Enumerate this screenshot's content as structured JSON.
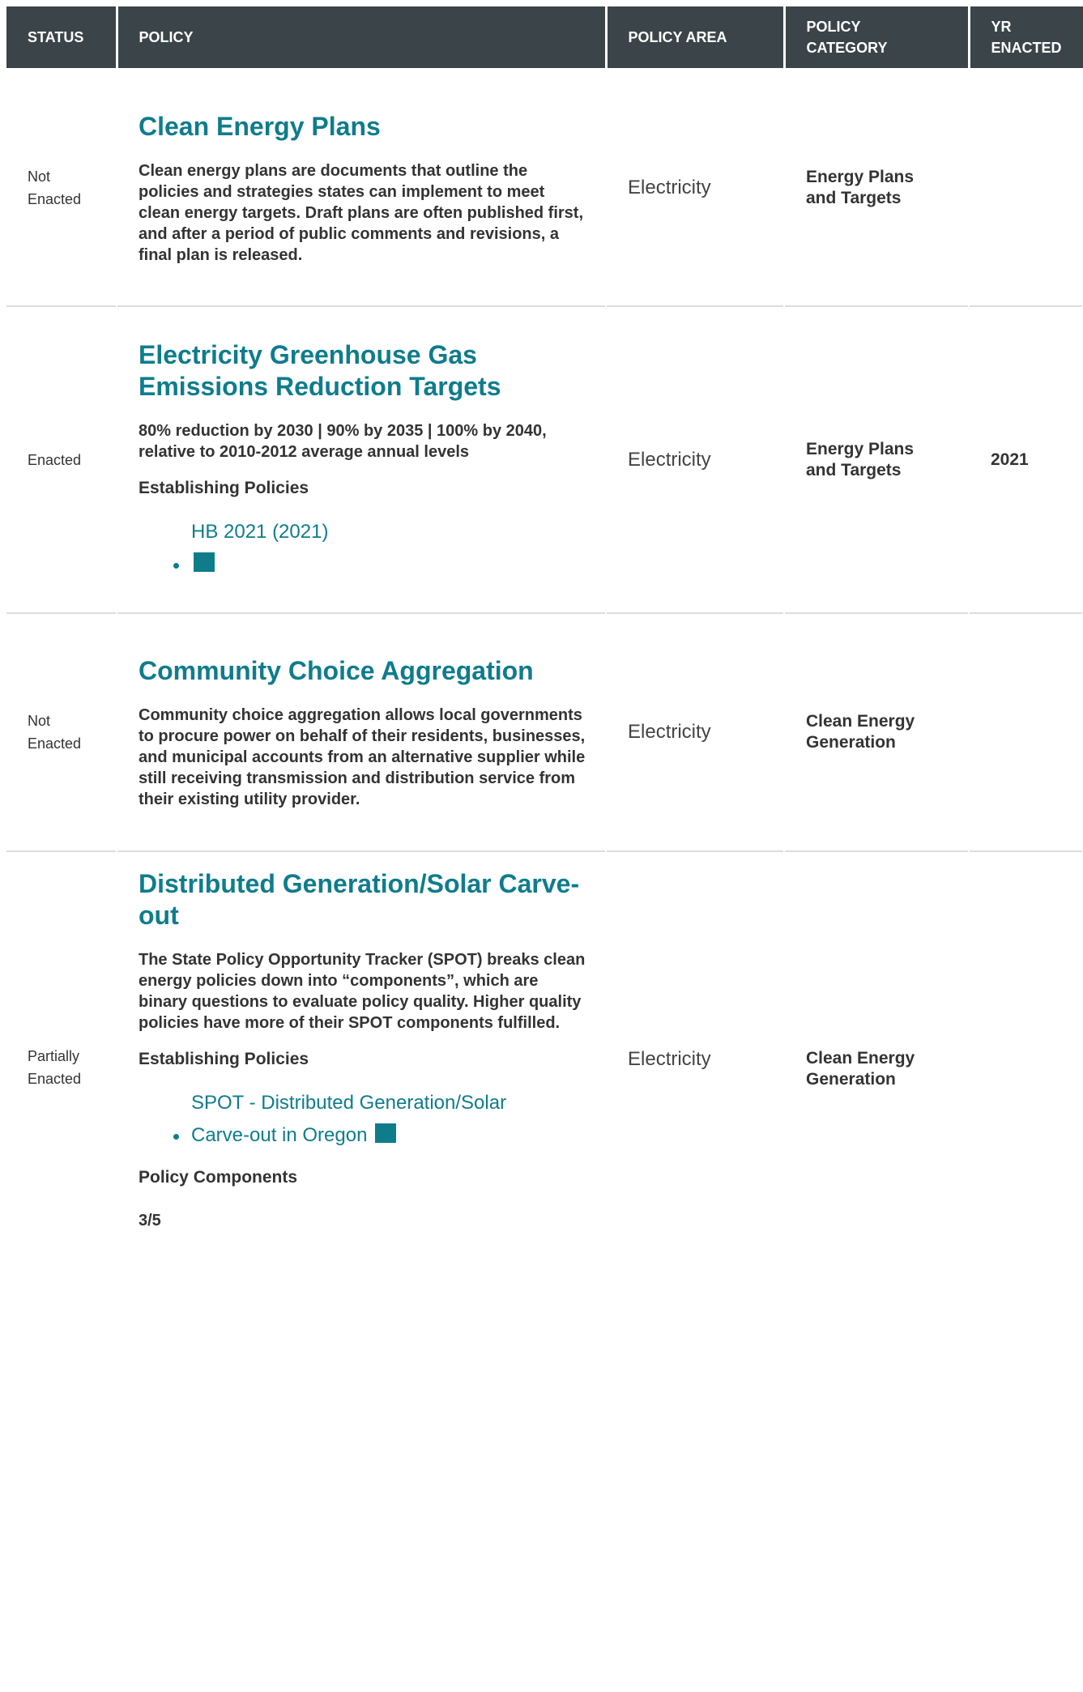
{
  "headers": {
    "status": "STATUS",
    "policy": "POLICY",
    "area": "POLICY AREA",
    "category_line1": "POLICY",
    "category_line2": "CATEGORY",
    "yr_line1": "YR",
    "yr_line2": "ENACTED"
  },
  "rows": [
    {
      "status_line1": "Not",
      "status_line2": "Enacted",
      "title": "Clean Energy Plans",
      "description": "Clean energy plans are documents that outline the policies and strategies states can implement to meet clean energy targets. Draft plans are often published first, and after a period of public comments and revisions, a final plan is released.",
      "area": "Electricity",
      "category": "Energy Plans and Targets",
      "year": ""
    },
    {
      "status": "Enacted",
      "title": "Electricity Greenhouse Gas Emissions Reduction Targets",
      "description": "80% reduction by 2030 | 90% by 2035 | 100% by 2040, relative to 2010-2012 average annual levels",
      "establishing_label": "Establishing Policies",
      "link_line1": "HB 2021 (2021)",
      "area": "Electricity",
      "category": "Energy Plans and Targets",
      "year": "2021"
    },
    {
      "status_line1": "Not",
      "status_line2": "Enacted",
      "title": "Community Choice Aggregation",
      "description": "Community choice aggregation allows local governments to procure power on behalf of their residents, businesses, and municipal accounts from an alternative supplier while still receiving transmission and distribution service from their existing utility provider.",
      "area": "Electricity",
      "category": "Clean Energy Generation",
      "year": ""
    },
    {
      "status_line1": "Partially",
      "status_line2": "Enacted",
      "title": "Distributed Generation/Solar Carve-out",
      "description": "The State Policy Opportunity Tracker (SPOT) breaks clean energy policies down into “components”, which are binary questions to evaluate policy quality. Higher quality policies have more of their SPOT components fulfilled.",
      "establishing_label": "Establishing Policies",
      "link_line1": "SPOT - Distributed Generation/Solar",
      "link_line2": "Carve-out in Oregon",
      "components_label": "Policy Components",
      "components_value": "3/5",
      "area": "Electricity",
      "category": "Clean Energy Generation",
      "year": ""
    }
  ],
  "colors": {
    "header_bg": "#3b4449",
    "accent": "#0f7c8c",
    "divider": "#dcdcdc"
  },
  "icons": {
    "link_marker": "external-link-square-icon"
  }
}
